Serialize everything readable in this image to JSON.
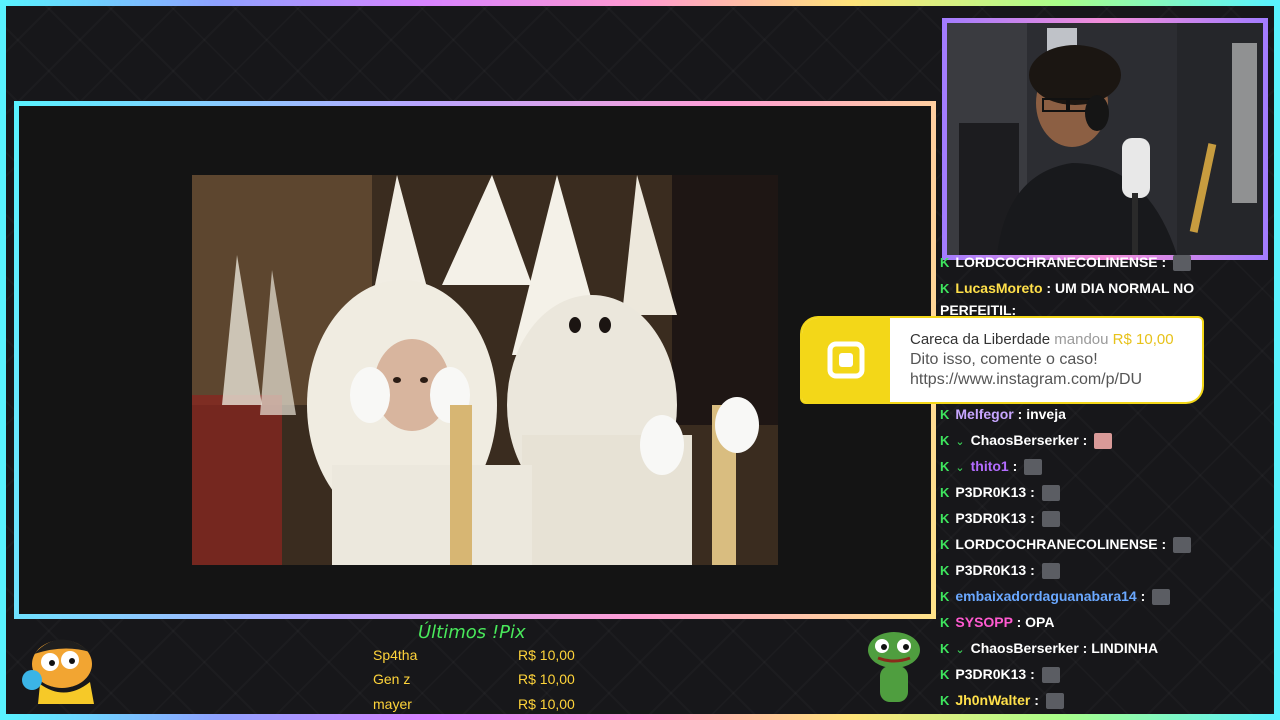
{
  "chat": {
    "messages": [
      {
        "user": "LORDCOCHRANECOLINENSE",
        "user_color": "#ffffff",
        "text": "",
        "emote": true,
        "badge": false
      },
      {
        "user": "LucasMoreto",
        "user_color": "#ffe04a",
        "text": "UM DIA NORMAL NO",
        "text2": "PERFEITIL:",
        "emote": false,
        "badge": false
      },
      {
        "user": "Melfegor",
        "user_color": "#c7a6ff",
        "text": "inveja",
        "emote": false,
        "badge": false
      },
      {
        "user": "ChaosBerserker",
        "user_color": "#ffffff",
        "text": "",
        "emote": true,
        "emote_color": "pink",
        "badge": true
      },
      {
        "user": "thito1",
        "user_color": "#b36cff",
        "text": "",
        "emote": true,
        "badge": true
      },
      {
        "user": "P3DR0K13",
        "user_color": "#ffffff",
        "text": "",
        "emote": true,
        "badge": false
      },
      {
        "user": "P3DR0K13",
        "user_color": "#ffffff",
        "text": "",
        "emote": true,
        "badge": false
      },
      {
        "user": "LORDCOCHRANECOLINENSE",
        "user_color": "#ffffff",
        "text": "",
        "emote": true,
        "badge": false
      },
      {
        "user": "P3DR0K13",
        "user_color": "#ffffff",
        "text": "",
        "emote": true,
        "badge": false
      },
      {
        "user": "embaixadordaguanabara14",
        "user_color": "#6aa8ff",
        "text": "",
        "emote": true,
        "badge": false
      },
      {
        "user": "SYSOPP",
        "user_color": "#ff5ad0",
        "text": "OPA",
        "emote": false,
        "badge": false
      },
      {
        "user": "ChaosBerserker",
        "user_color": "#ffffff",
        "text": "LINDINHA",
        "emote": false,
        "badge": true
      },
      {
        "user": "P3DR0K13",
        "user_color": "#ffffff",
        "text": "",
        "emote": true,
        "badge": false
      },
      {
        "user": "Jh0nWalter",
        "user_color": "#ffe04a",
        "text": "",
        "emote": true,
        "badge": false
      }
    ]
  },
  "alert": {
    "donor": "Careca da Liberdade",
    "verb": "mandou",
    "amount": "R$ 10,00",
    "message": "Dito isso, comente o caso!",
    "link": "https://www.instagram.com/p/DU"
  },
  "pix": {
    "title": "Últimos !Pix",
    "rows": [
      {
        "name": "Sp4tha",
        "amount": "R$ 10,00"
      },
      {
        "name": "Gen z",
        "amount": "R$ 10,00"
      },
      {
        "name": "mayer",
        "amount": "R$ 10,00"
      }
    ]
  },
  "colors": {
    "accent_green": "#3ee65e",
    "alert_yellow": "#f3d718",
    "pix_amount": "#ffd43a"
  },
  "icons": {
    "alert_logo": "pix-logo-icon",
    "chat_badge": "k-icon"
  }
}
